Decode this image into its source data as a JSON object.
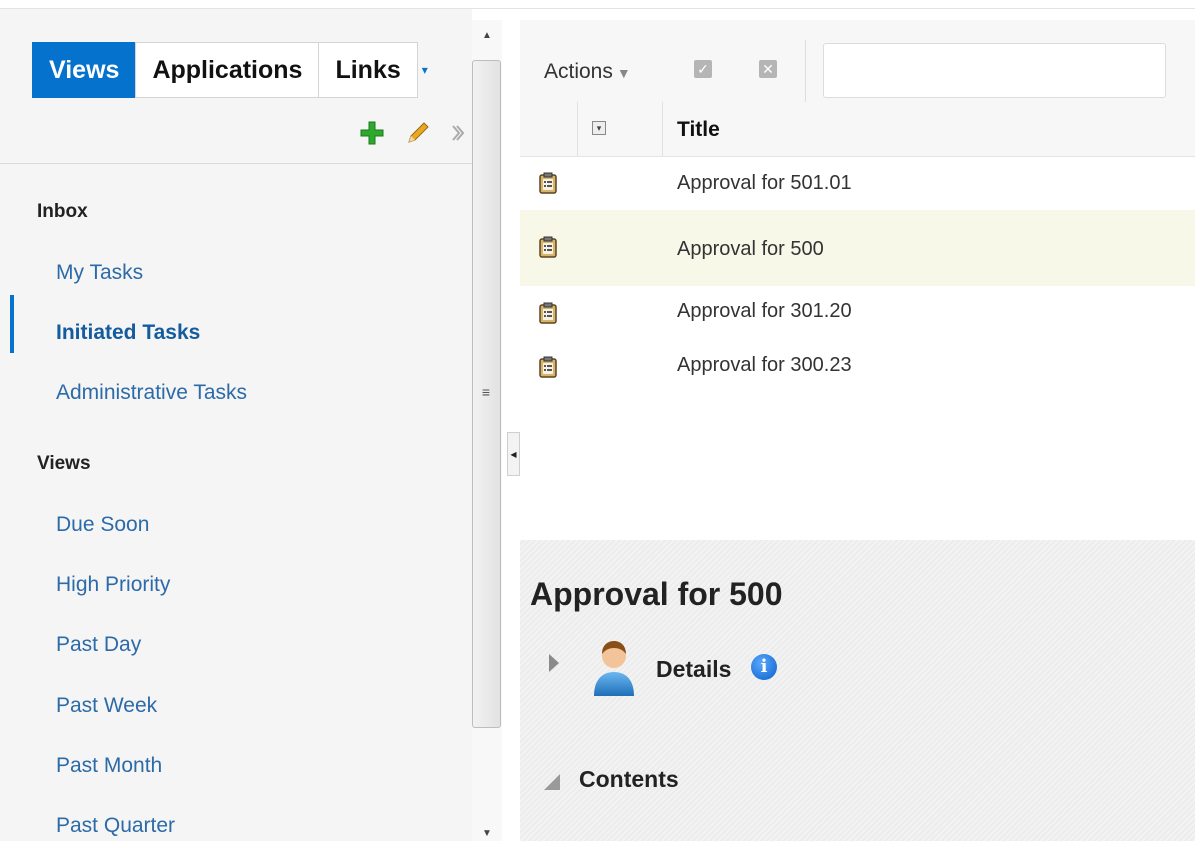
{
  "left_panel": {
    "tabs": [
      {
        "label": "Views",
        "active": true
      },
      {
        "label": "Applications",
        "active": false
      },
      {
        "label": "Links",
        "active": false
      }
    ],
    "toolbar_icons": [
      "add-icon",
      "edit-icon",
      "chevron-right-icon"
    ],
    "inbox_heading": "Inbox",
    "inbox_items": [
      {
        "label": "My Tasks",
        "active": false
      },
      {
        "label": "Initiated Tasks",
        "active": true
      },
      {
        "label": "Administrative Tasks",
        "active": false
      }
    ],
    "views_heading": "Views",
    "views_items": [
      {
        "label": "Due Soon"
      },
      {
        "label": "High Priority"
      },
      {
        "label": "Past Day"
      },
      {
        "label": "Past Week"
      },
      {
        "label": "Past Month"
      },
      {
        "label": "Past Quarter"
      }
    ]
  },
  "task_list": {
    "actions_label": "Actions",
    "search_value": "",
    "column_title": "Title",
    "rows": [
      {
        "title": "Approval for 501.01",
        "selected": false
      },
      {
        "title": "Approval for 500",
        "selected": true
      },
      {
        "title": "Approval for 301.20",
        "selected": false
      },
      {
        "title": "Approval for 300.23",
        "selected": false
      }
    ]
  },
  "detail": {
    "title": "Approval for 500",
    "details_label": "Details",
    "contents_label": "Contents"
  },
  "colors": {
    "accent": "#0572ce",
    "link": "#2c6aa8",
    "add_icon": "#2fa82f",
    "edit_icon": "#e0a020"
  }
}
